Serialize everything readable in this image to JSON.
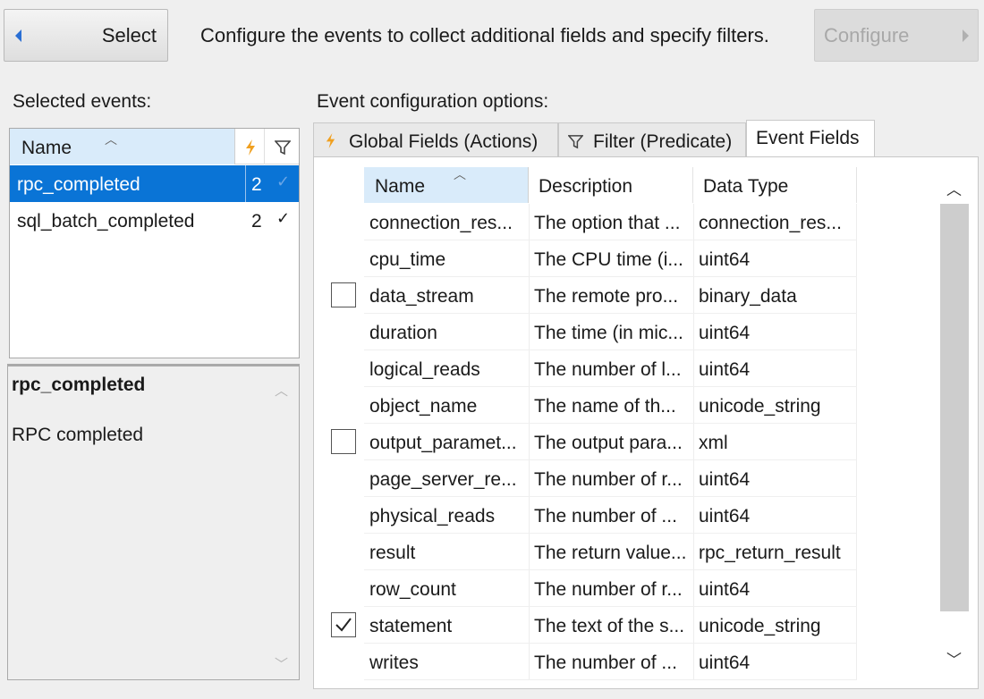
{
  "toolbar": {
    "select_label": "Select",
    "instruction": "Configure the events to collect additional fields and specify filters.",
    "configure_label": "Configure"
  },
  "events": {
    "section_label": "Selected events:",
    "header_name": "Name",
    "rows": [
      {
        "name": "rpc_completed",
        "count": "2",
        "selected": true
      },
      {
        "name": "sql_batch_completed",
        "count": "2",
        "selected": false
      }
    ]
  },
  "description": {
    "title": "rpc_completed",
    "text": "RPC completed"
  },
  "config": {
    "section_label": "Event configuration options:",
    "tabs": [
      "Global Fields (Actions)",
      "Filter (Predicate)",
      "Event Fields"
    ],
    "columns": [
      "Name",
      "Description",
      "Data Type"
    ],
    "fields": [
      {
        "name": "connection_res...",
        "description": "The option that ...",
        "type": "connection_res...",
        "checkbox": "none"
      },
      {
        "name": "cpu_time",
        "description": "The CPU time (i...",
        "type": "uint64",
        "checkbox": "none"
      },
      {
        "name": "data_stream",
        "description": "The remote pro...",
        "type": "binary_data",
        "checkbox": "unchecked"
      },
      {
        "name": "duration",
        "description": "The time (in mic...",
        "type": "uint64",
        "checkbox": "none"
      },
      {
        "name": "logical_reads",
        "description": "The number of l...",
        "type": "uint64",
        "checkbox": "none"
      },
      {
        "name": "object_name",
        "description": "The name of th...",
        "type": "unicode_string",
        "checkbox": "none"
      },
      {
        "name": "output_paramet...",
        "description": "The output para...",
        "type": "xml",
        "checkbox": "unchecked"
      },
      {
        "name": "page_server_re...",
        "description": "The number of r...",
        "type": "uint64",
        "checkbox": "none"
      },
      {
        "name": "physical_reads",
        "description": "The number of ...",
        "type": "uint64",
        "checkbox": "none"
      },
      {
        "name": "result",
        "description": "The return value...",
        "type": "rpc_return_result",
        "checkbox": "none"
      },
      {
        "name": "row_count",
        "description": "The number of r...",
        "type": "uint64",
        "checkbox": "none"
      },
      {
        "name": "statement",
        "description": "The text of the s...",
        "type": "unicode_string",
        "checkbox": "checked"
      },
      {
        "name": "writes",
        "description": "The number of ...",
        "type": "uint64",
        "checkbox": "none"
      }
    ]
  },
  "colors": {
    "selection": "#0a74d6",
    "header_highlight": "#d9ebfa",
    "action_icon": "#f0a020"
  }
}
